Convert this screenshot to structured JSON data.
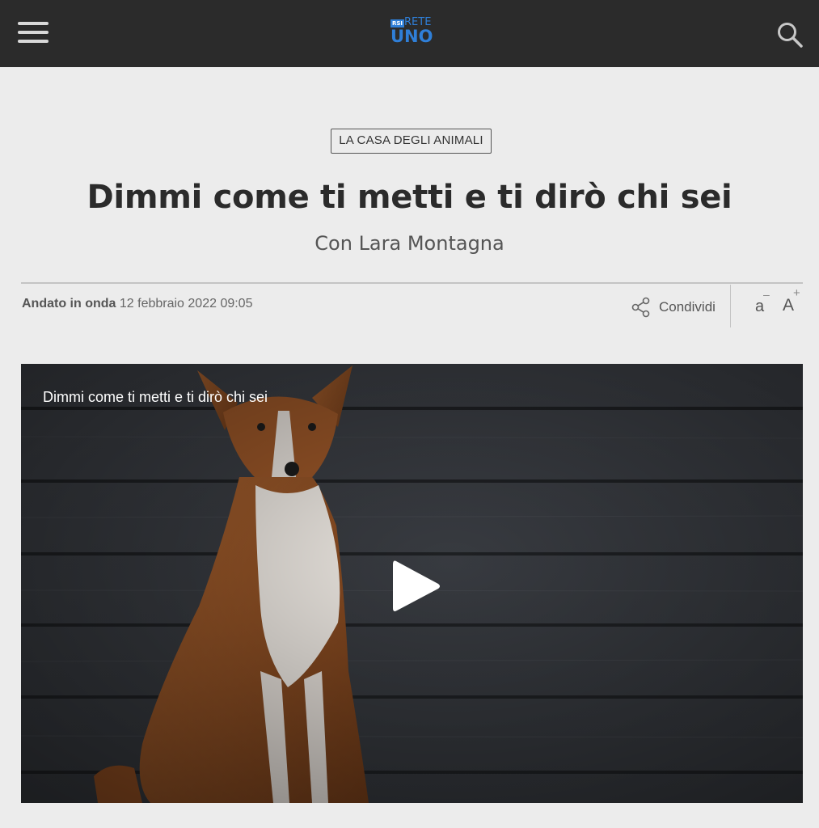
{
  "header": {
    "logo": {
      "rsi": "RSI",
      "rete": "RETE",
      "uno": "UNO",
      "color": "#2f7fd8"
    },
    "menu_icon": "hamburger-menu-icon",
    "search_icon": "search-icon",
    "background": "#2b2b2b"
  },
  "article": {
    "category": "LA CASA DEGLI ANIMALI",
    "title": "Dimmi come ti metti e ti dirò chi sei",
    "subtitle": "Con Lara Montagna",
    "aired_label": "Andato in onda",
    "aired_date": "12 febbraio 2022 09:05",
    "share_label": "Condividi",
    "font_decrease": {
      "glyph": "a",
      "sign": "–"
    },
    "font_increase": {
      "glyph": "A",
      "sign": "+"
    }
  },
  "video": {
    "title": "Dimmi come ti metti e ti dirò chi sei",
    "play_icon": "play-icon"
  }
}
